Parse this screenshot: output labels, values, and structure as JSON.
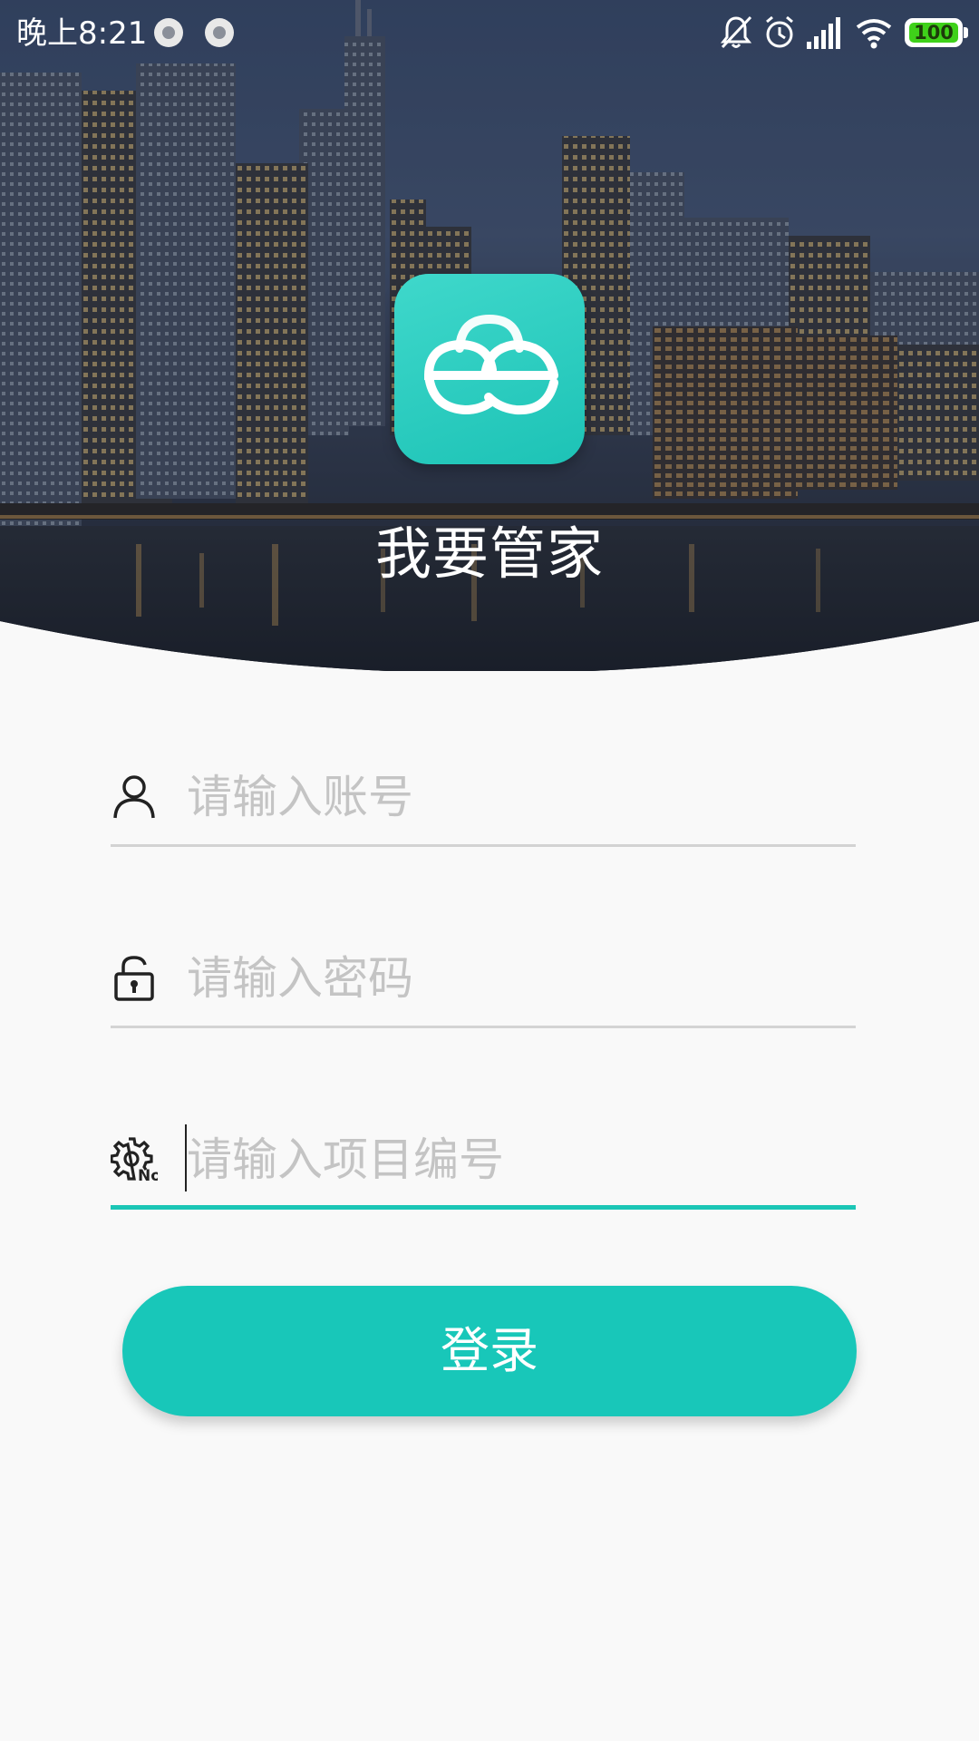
{
  "status_bar": {
    "time": "晚上8:21",
    "battery_level": "100",
    "icons": [
      "record-dot-icon",
      "record-dot-icon",
      "mute-bell-icon",
      "alarm-icon",
      "signal-icon",
      "wifi-icon",
      "battery-icon"
    ]
  },
  "header": {
    "app_name": "我要管家",
    "logo_icon": "cloud-ee-logo",
    "background": "night-city-skyline"
  },
  "form": {
    "account": {
      "icon": "user-icon",
      "placeholder": "请输入账号",
      "value": ""
    },
    "password": {
      "icon": "lock-icon",
      "placeholder": "请输入密码",
      "value": ""
    },
    "project": {
      "icon": "gear-no-icon",
      "placeholder": "请输入项目编号",
      "value": "",
      "focused": true
    },
    "login_label": "登录"
  },
  "colors": {
    "accent": "#18c7b9",
    "background": "#f9f9f9",
    "placeholder": "#c4c4c4",
    "divider": "#d3d3d3",
    "battery": "#3fd11a"
  }
}
